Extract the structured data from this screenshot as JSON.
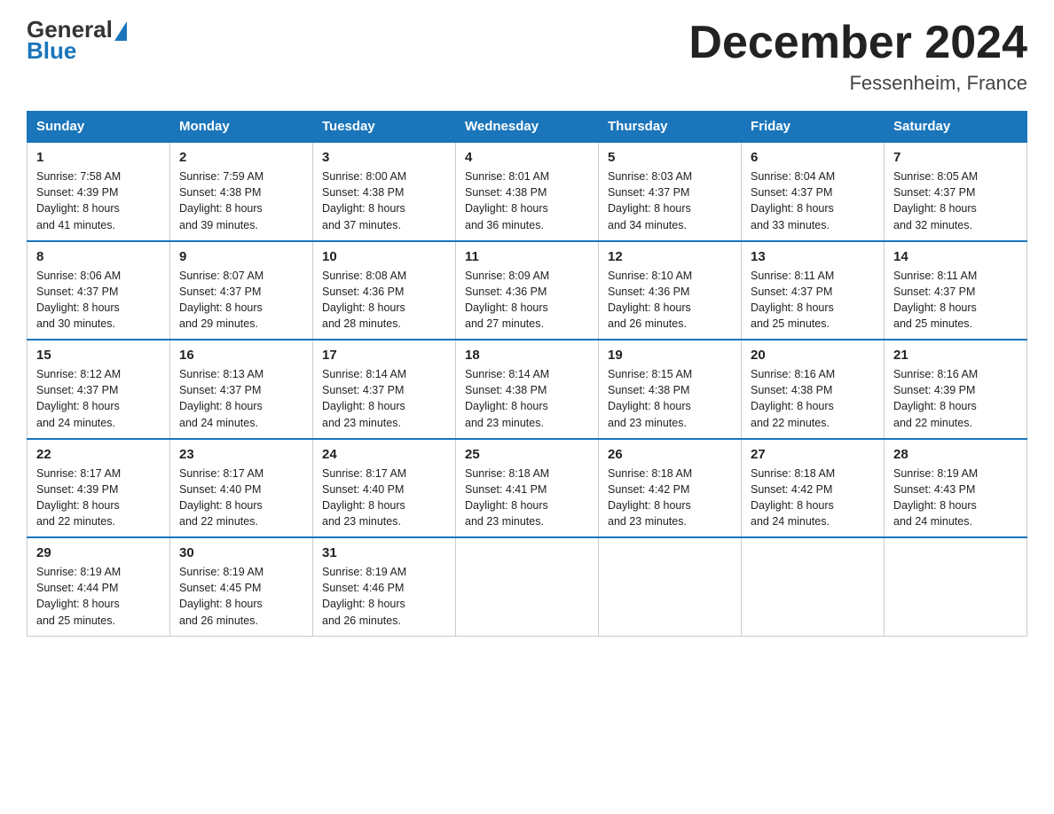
{
  "logo": {
    "general": "General",
    "blue": "Blue"
  },
  "title": "December 2024",
  "location": "Fessenheim, France",
  "days_of_week": [
    "Sunday",
    "Monday",
    "Tuesday",
    "Wednesday",
    "Thursday",
    "Friday",
    "Saturday"
  ],
  "weeks": [
    [
      {
        "day": "1",
        "sunrise": "7:58 AM",
        "sunset": "4:39 PM",
        "daylight": "8 hours and 41 minutes."
      },
      {
        "day": "2",
        "sunrise": "7:59 AM",
        "sunset": "4:38 PM",
        "daylight": "8 hours and 39 minutes."
      },
      {
        "day": "3",
        "sunrise": "8:00 AM",
        "sunset": "4:38 PM",
        "daylight": "8 hours and 37 minutes."
      },
      {
        "day": "4",
        "sunrise": "8:01 AM",
        "sunset": "4:38 PM",
        "daylight": "8 hours and 36 minutes."
      },
      {
        "day": "5",
        "sunrise": "8:03 AM",
        "sunset": "4:37 PM",
        "daylight": "8 hours and 34 minutes."
      },
      {
        "day": "6",
        "sunrise": "8:04 AM",
        "sunset": "4:37 PM",
        "daylight": "8 hours and 33 minutes."
      },
      {
        "day": "7",
        "sunrise": "8:05 AM",
        "sunset": "4:37 PM",
        "daylight": "8 hours and 32 minutes."
      }
    ],
    [
      {
        "day": "8",
        "sunrise": "8:06 AM",
        "sunset": "4:37 PM",
        "daylight": "8 hours and 30 minutes."
      },
      {
        "day": "9",
        "sunrise": "8:07 AM",
        "sunset": "4:37 PM",
        "daylight": "8 hours and 29 minutes."
      },
      {
        "day": "10",
        "sunrise": "8:08 AM",
        "sunset": "4:36 PM",
        "daylight": "8 hours and 28 minutes."
      },
      {
        "day": "11",
        "sunrise": "8:09 AM",
        "sunset": "4:36 PM",
        "daylight": "8 hours and 27 minutes."
      },
      {
        "day": "12",
        "sunrise": "8:10 AM",
        "sunset": "4:36 PM",
        "daylight": "8 hours and 26 minutes."
      },
      {
        "day": "13",
        "sunrise": "8:11 AM",
        "sunset": "4:37 PM",
        "daylight": "8 hours and 25 minutes."
      },
      {
        "day": "14",
        "sunrise": "8:11 AM",
        "sunset": "4:37 PM",
        "daylight": "8 hours and 25 minutes."
      }
    ],
    [
      {
        "day": "15",
        "sunrise": "8:12 AM",
        "sunset": "4:37 PM",
        "daylight": "8 hours and 24 minutes."
      },
      {
        "day": "16",
        "sunrise": "8:13 AM",
        "sunset": "4:37 PM",
        "daylight": "8 hours and 24 minutes."
      },
      {
        "day": "17",
        "sunrise": "8:14 AM",
        "sunset": "4:37 PM",
        "daylight": "8 hours and 23 minutes."
      },
      {
        "day": "18",
        "sunrise": "8:14 AM",
        "sunset": "4:38 PM",
        "daylight": "8 hours and 23 minutes."
      },
      {
        "day": "19",
        "sunrise": "8:15 AM",
        "sunset": "4:38 PM",
        "daylight": "8 hours and 23 minutes."
      },
      {
        "day": "20",
        "sunrise": "8:16 AM",
        "sunset": "4:38 PM",
        "daylight": "8 hours and 22 minutes."
      },
      {
        "day": "21",
        "sunrise": "8:16 AM",
        "sunset": "4:39 PM",
        "daylight": "8 hours and 22 minutes."
      }
    ],
    [
      {
        "day": "22",
        "sunrise": "8:17 AM",
        "sunset": "4:39 PM",
        "daylight": "8 hours and 22 minutes."
      },
      {
        "day": "23",
        "sunrise": "8:17 AM",
        "sunset": "4:40 PM",
        "daylight": "8 hours and 22 minutes."
      },
      {
        "day": "24",
        "sunrise": "8:17 AM",
        "sunset": "4:40 PM",
        "daylight": "8 hours and 23 minutes."
      },
      {
        "day": "25",
        "sunrise": "8:18 AM",
        "sunset": "4:41 PM",
        "daylight": "8 hours and 23 minutes."
      },
      {
        "day": "26",
        "sunrise": "8:18 AM",
        "sunset": "4:42 PM",
        "daylight": "8 hours and 23 minutes."
      },
      {
        "day": "27",
        "sunrise": "8:18 AM",
        "sunset": "4:42 PM",
        "daylight": "8 hours and 24 minutes."
      },
      {
        "day": "28",
        "sunrise": "8:19 AM",
        "sunset": "4:43 PM",
        "daylight": "8 hours and 24 minutes."
      }
    ],
    [
      {
        "day": "29",
        "sunrise": "8:19 AM",
        "sunset": "4:44 PM",
        "daylight": "8 hours and 25 minutes."
      },
      {
        "day": "30",
        "sunrise": "8:19 AM",
        "sunset": "4:45 PM",
        "daylight": "8 hours and 26 minutes."
      },
      {
        "day": "31",
        "sunrise": "8:19 AM",
        "sunset": "4:46 PM",
        "daylight": "8 hours and 26 minutes."
      },
      null,
      null,
      null,
      null
    ]
  ],
  "labels": {
    "sunrise": "Sunrise:",
    "sunset": "Sunset:",
    "daylight": "Daylight:"
  },
  "colors": {
    "header_bg": "#1a75bb",
    "header_text": "#ffffff",
    "border": "#1a75bb"
  }
}
